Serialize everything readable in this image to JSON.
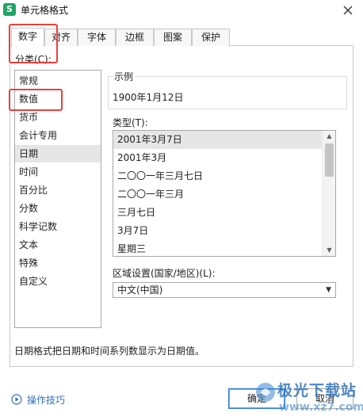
{
  "window": {
    "title": "单元格格式",
    "app_icon": "S"
  },
  "tabs": [
    "数字",
    "对齐",
    "字体",
    "边框",
    "图案",
    "保护"
  ],
  "category": {
    "label": "分类(C):",
    "items": [
      "常规",
      "数值",
      "货币",
      "会计专用",
      "日期",
      "时间",
      "百分比",
      "分数",
      "科学记数",
      "文本",
      "特殊",
      "自定义"
    ],
    "selected": "日期"
  },
  "sample": {
    "label": "示例",
    "value": "1900年1月12日"
  },
  "type": {
    "label": "类型(T):",
    "items": [
      "2001年3月7日",
      "2001年3月",
      "二〇〇一年三月七日",
      "二〇〇一年三月",
      "三月七日",
      "3月7日",
      "星期三"
    ],
    "selected": "2001年3月7日"
  },
  "region": {
    "label": "区域设置(国家/地区)(L):",
    "value": "中文(中国)"
  },
  "description": "日期格式把日期和时间系列数显示为日期值。",
  "footer": {
    "tips_label": "操作技巧",
    "ok_label": "确定",
    "cancel_label": "取消"
  },
  "watermark": {
    "brand": "极光下载站",
    "url": "www.xz7.com"
  },
  "colors": {
    "highlight": "#e8413b",
    "accent": "#2c7be5",
    "app_icon": "#21a366",
    "link": "#2f6fbf"
  }
}
